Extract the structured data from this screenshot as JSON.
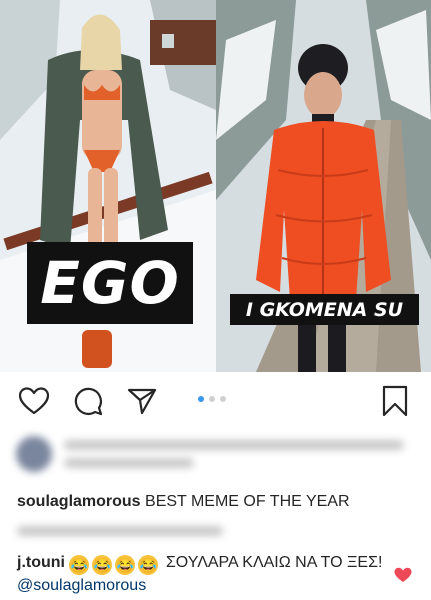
{
  "photo": {
    "left_caption": "EGO",
    "right_caption": "I GKOMENA SU"
  },
  "actions": {
    "like_icon": "heart-outline-icon",
    "comment_icon": "comment-bubble-icon",
    "share_icon": "send-paper-plane-icon",
    "save_icon": "bookmark-icon",
    "carousel_dots": 3,
    "carousel_active_index": 0
  },
  "post_caption": {
    "username": "soulaglamorous",
    "text": "BEST MEME OF THE YEAR"
  },
  "comment": {
    "username": "j.touni",
    "emoji": "😂",
    "text": "ΣΟΥΛΑΡΑ ΚΛΑΙΩ ΝΑ ΤΟ ΞΕΣ!",
    "mention": "@soulaglamorous",
    "liked": true
  },
  "colors": {
    "accent_blue": "#3897f0",
    "heart_red": "#ed4956",
    "mention_blue": "#00376b"
  }
}
